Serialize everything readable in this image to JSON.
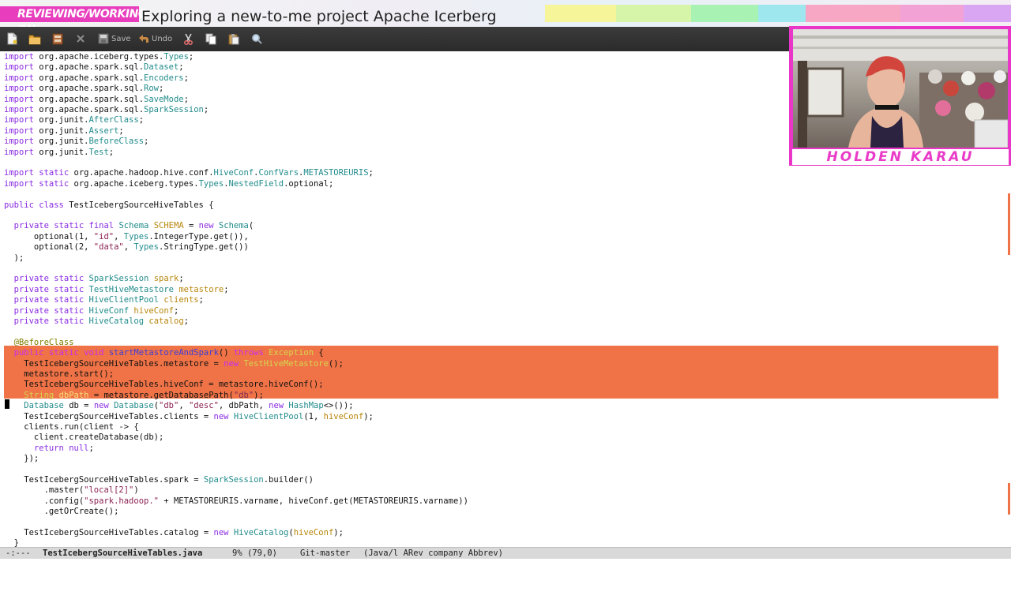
{
  "banner": {
    "label": "REVIEWING/WORKING ON:",
    "title": "Exploring a new-to-me project Apache Icerberg"
  },
  "toolbar": {
    "icons": [
      "new-file-icon",
      "open-folder-icon",
      "dired-icon",
      "close-icon",
      "save-icon",
      "undo-icon",
      "cut-icon",
      "copy-icon",
      "paste-icon",
      "search-icon"
    ],
    "save_label": "Save",
    "undo_label": "Undo"
  },
  "webcam": {
    "name": "HOLDEN KARAU"
  },
  "editor": {
    "lines": [
      "import org.apache.iceberg.types.Types;",
      "import org.apache.spark.sql.Dataset;",
      "import org.apache.spark.sql.Encoders;",
      "import org.apache.spark.sql.Row;",
      "import org.apache.spark.sql.SaveMode;",
      "import org.apache.spark.sql.SparkSession;",
      "import org.junit.AfterClass;",
      "import org.junit.Assert;",
      "import org.junit.BeforeClass;",
      "import org.junit.Test;",
      "",
      "import static org.apache.hadoop.hive.conf.HiveConf.ConfVars.METASTOREURIS;",
      "import static org.apache.iceberg.types.Types.NestedField.optional;",
      "",
      "public class TestIcebergSourceHiveTables {",
      "",
      "  private static final Schema SCHEMA = new Schema(",
      "      optional(1, \"id\", Types.IntegerType.get()),",
      "      optional(2, \"data\", Types.StringType.get())",
      "  );",
      "",
      "  private static SparkSession spark;",
      "  private static TestHiveMetastore metastore;",
      "  private static HiveClientPool clients;",
      "  private static HiveConf hiveConf;",
      "  private static HiveCatalog catalog;",
      "",
      "  @BeforeClass",
      "  public static void startMetastoreAndSpark() throws Exception {",
      "    TestIcebergSourceHiveTables.metastore = new TestHiveMetastore();",
      "    metastore.start();",
      "    TestIcebergSourceHiveTables.hiveConf = metastore.hiveConf();",
      "    String dbPath = metastore.getDatabasePath(\"db\");",
      "    Database db = new Database(\"db\", \"desc\", dbPath, new HashMap<>());",
      "    TestIcebergSourceHiveTables.clients = new HiveClientPool(1, hiveConf);",
      "    clients.run(client -> {",
      "      client.createDatabase(db);",
      "      return null;",
      "    });",
      "",
      "    TestIcebergSourceHiveTables.spark = SparkSession.builder()",
      "        .master(\"local[2]\")",
      "        .config(\"spark.hadoop.\" + METASTOREURIS.varname, hiveConf.get(METASTOREURIS.varname))",
      "        .getOrCreate();",
      "",
      "    TestIcebergSourceHiveTables.catalog = new HiveCatalog(hiveConf);",
      "  }"
    ]
  },
  "modeline": {
    "status": "-:---",
    "buffer": "TestIcebergSourceHiveTables.java",
    "position": "9% (79,0)",
    "vc": "Git-master",
    "modes": "(Java/l ARev company Abbrev)"
  }
}
